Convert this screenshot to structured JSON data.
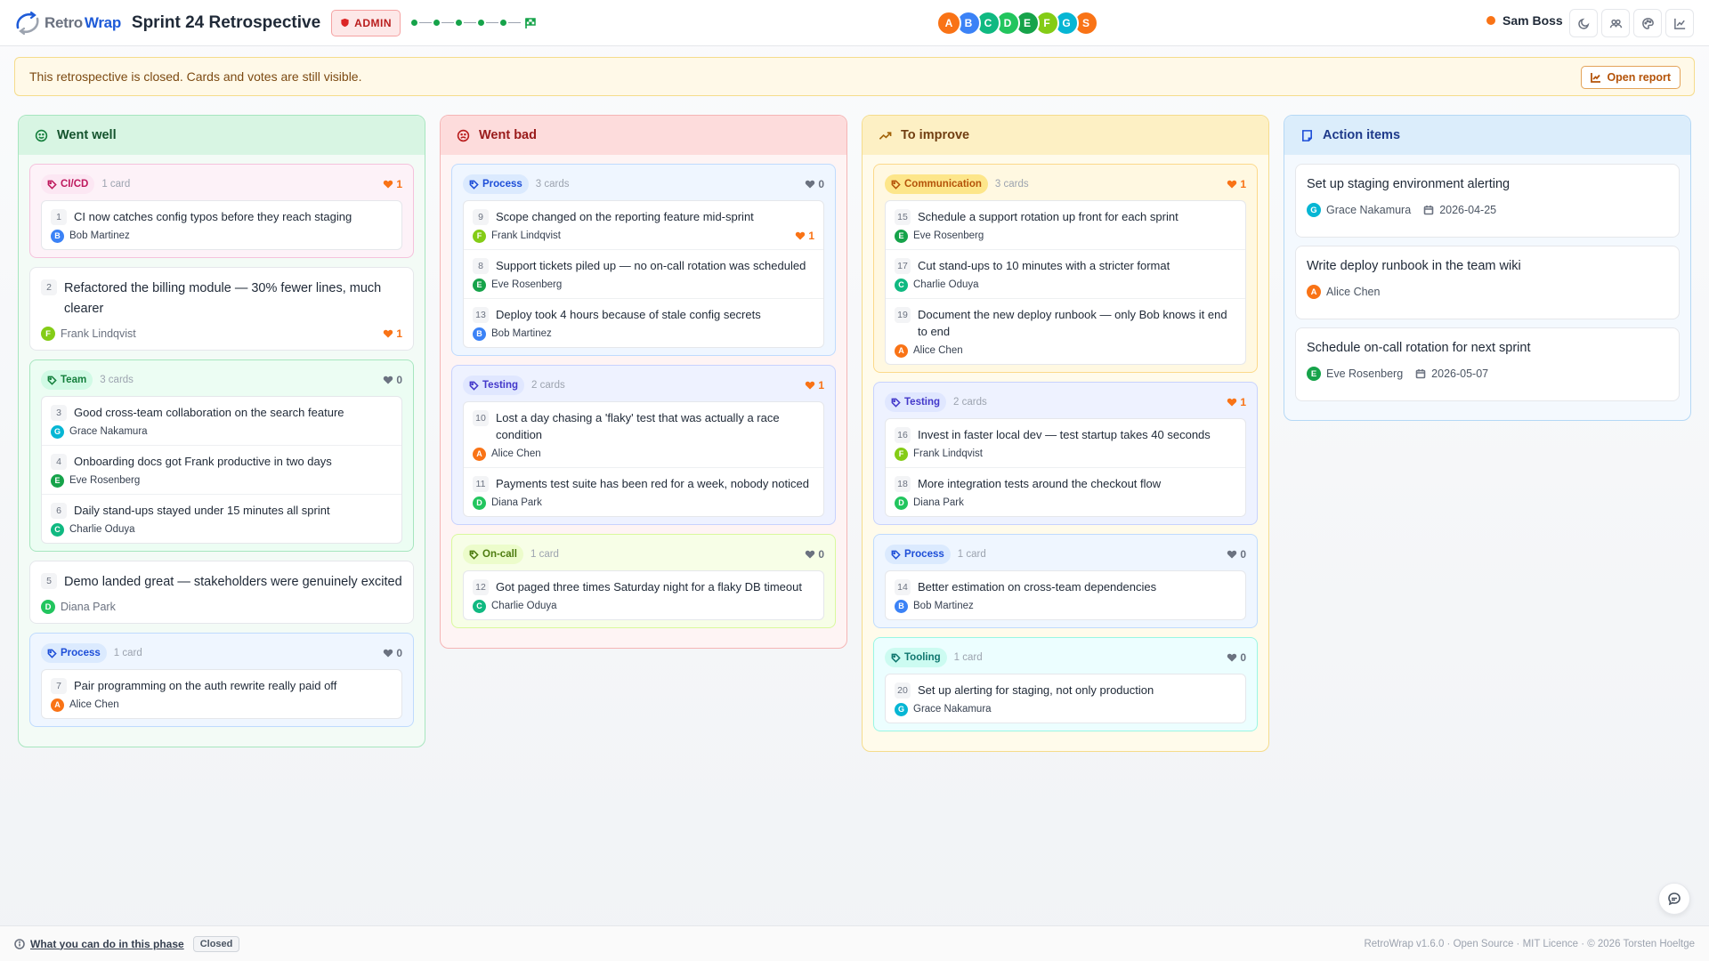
{
  "header": {
    "logo_part1": "Retro",
    "logo_part2": "Wrap",
    "title": "Sprint 24 Retrospective",
    "admin_badge": "ADMIN",
    "participants": [
      {
        "initial": "A",
        "color": "#f97316"
      },
      {
        "initial": "B",
        "color": "#3b82f6"
      },
      {
        "initial": "C",
        "color": "#10b981"
      },
      {
        "initial": "D",
        "color": "#22c55e"
      },
      {
        "initial": "E",
        "color": "#16a34a"
      },
      {
        "initial": "F",
        "color": "#84cc16"
      },
      {
        "initial": "G",
        "color": "#06b6d4"
      },
      {
        "initial": "S",
        "color": "#f97316"
      }
    ],
    "user_name": "Sam Boss",
    "user_status_color": "#f97316"
  },
  "banner": {
    "message": "This retrospective is closed. Cards and votes are still visible.",
    "open_report_label": "Open report"
  },
  "columns": {
    "went_well": {
      "title": "Went well",
      "g_cicd": {
        "tag": "CI/CD",
        "count": "1 card",
        "votes": "1",
        "cards": [
          {
            "num": "1",
            "text": "CI now catches config typos before they reach staging",
            "author": "Bob Martinez",
            "initial": "B"
          }
        ]
      },
      "solo_2": {
        "num": "2",
        "text": "Refactored the billing module — 30% fewer lines, much clearer",
        "author": "Frank Lindqvist",
        "initial": "F",
        "votes": "1"
      },
      "g_team": {
        "tag": "Team",
        "count": "3 cards",
        "votes": "0",
        "cards": [
          {
            "num": "3",
            "text": "Good cross-team collaboration on the search feature",
            "author": "Grace Nakamura",
            "initial": "G"
          },
          {
            "num": "4",
            "text": "Onboarding docs got Frank productive in two days",
            "author": "Eve Rosenberg",
            "initial": "E"
          },
          {
            "num": "6",
            "text": "Daily stand-ups stayed under 15 minutes all sprint",
            "author": "Charlie Oduya",
            "initial": "C"
          }
        ]
      },
      "solo_5": {
        "num": "5",
        "text": "Demo landed great — stakeholders were genuinely excited",
        "author": "Diana Park",
        "initial": "D"
      },
      "g_process": {
        "tag": "Process",
        "count": "1 card",
        "votes": "0",
        "cards": [
          {
            "num": "7",
            "text": "Pair programming on the auth rewrite really paid off",
            "author": "Alice Chen",
            "initial": "A"
          }
        ]
      }
    },
    "went_bad": {
      "title": "Went bad",
      "g_process": {
        "tag": "Process",
        "count": "3 cards",
        "votes": "0",
        "cards": [
          {
            "num": "9",
            "text": "Scope changed on the reporting feature mid-sprint",
            "author": "Frank Lindqvist",
            "initial": "F",
            "votes": "1"
          },
          {
            "num": "8",
            "text": "Support tickets piled up — no on-call rotation was scheduled",
            "author": "Eve Rosenberg",
            "initial": "E"
          },
          {
            "num": "13",
            "text": "Deploy took 4 hours because of stale config secrets",
            "author": "Bob Martinez",
            "initial": "B"
          }
        ]
      },
      "g_testing": {
        "tag": "Testing",
        "count": "2 cards",
        "votes": "1",
        "cards": [
          {
            "num": "10",
            "text": "Lost a day chasing a 'flaky' test that was actually a race condition",
            "author": "Alice Chen",
            "initial": "A"
          },
          {
            "num": "11",
            "text": "Payments test suite has been red for a week, nobody noticed",
            "author": "Diana Park",
            "initial": "D"
          }
        ]
      },
      "g_oncall": {
        "tag": "On-call",
        "count": "1 card",
        "votes": "0",
        "cards": [
          {
            "num": "12",
            "text": "Got paged three times Saturday night for a flaky DB timeout",
            "author": "Charlie Oduya",
            "initial": "C"
          }
        ]
      }
    },
    "to_improve": {
      "title": "To improve",
      "g_comm": {
        "tag": "Communication",
        "count": "3 cards",
        "votes": "1",
        "cards": [
          {
            "num": "15",
            "text": "Schedule a support rotation up front for each sprint",
            "author": "Eve Rosenberg",
            "initial": "E"
          },
          {
            "num": "17",
            "text": "Cut stand-ups to 10 minutes with a stricter format",
            "author": "Charlie Oduya",
            "initial": "C"
          },
          {
            "num": "19",
            "text": "Document the new deploy runbook — only Bob knows it end to end",
            "author": "Alice Chen",
            "initial": "A"
          }
        ]
      },
      "g_testing": {
        "tag": "Testing",
        "count": "2 cards",
        "votes": "1",
        "cards": [
          {
            "num": "16",
            "text": "Invest in faster local dev — test startup takes 40 seconds",
            "author": "Frank Lindqvist",
            "initial": "F"
          },
          {
            "num": "18",
            "text": "More integration tests around the checkout flow",
            "author": "Diana Park",
            "initial": "D"
          }
        ]
      },
      "g_process": {
        "tag": "Process",
        "count": "1 card",
        "votes": "0",
        "cards": [
          {
            "num": "14",
            "text": "Better estimation on cross-team dependencies",
            "author": "Bob Martinez",
            "initial": "B"
          }
        ]
      },
      "g_tooling": {
        "tag": "Tooling",
        "count": "1 card",
        "votes": "0",
        "cards": [
          {
            "num": "20",
            "text": "Set up alerting for staging, not only production",
            "author": "Grace Nakamura",
            "initial": "G"
          }
        ]
      }
    },
    "action_items": {
      "title": "Action items",
      "items": [
        {
          "title": "Set up staging environment alerting",
          "owner": "Grace Nakamura",
          "initial": "G",
          "due": "2026-04-25"
        },
        {
          "title": "Write deploy runbook in the team wiki",
          "owner": "Alice Chen",
          "initial": "A"
        },
        {
          "title": "Schedule on-call rotation for next sprint",
          "owner": "Eve Rosenberg",
          "initial": "E",
          "due": "2026-05-07"
        }
      ]
    }
  },
  "footer": {
    "help_link": "What you can do in this phase",
    "phase_status": "Closed",
    "credits": "RetroWrap v1.6.0 · Open Source · MIT Licence · © 2026 Torsten Hoeltge"
  },
  "avatar_colors": {
    "A": "#f97316",
    "B": "#3b82f6",
    "C": "#10b981",
    "D": "#22c55e",
    "E": "#16a34a",
    "F": "#84cc16",
    "G": "#06b6d4"
  }
}
